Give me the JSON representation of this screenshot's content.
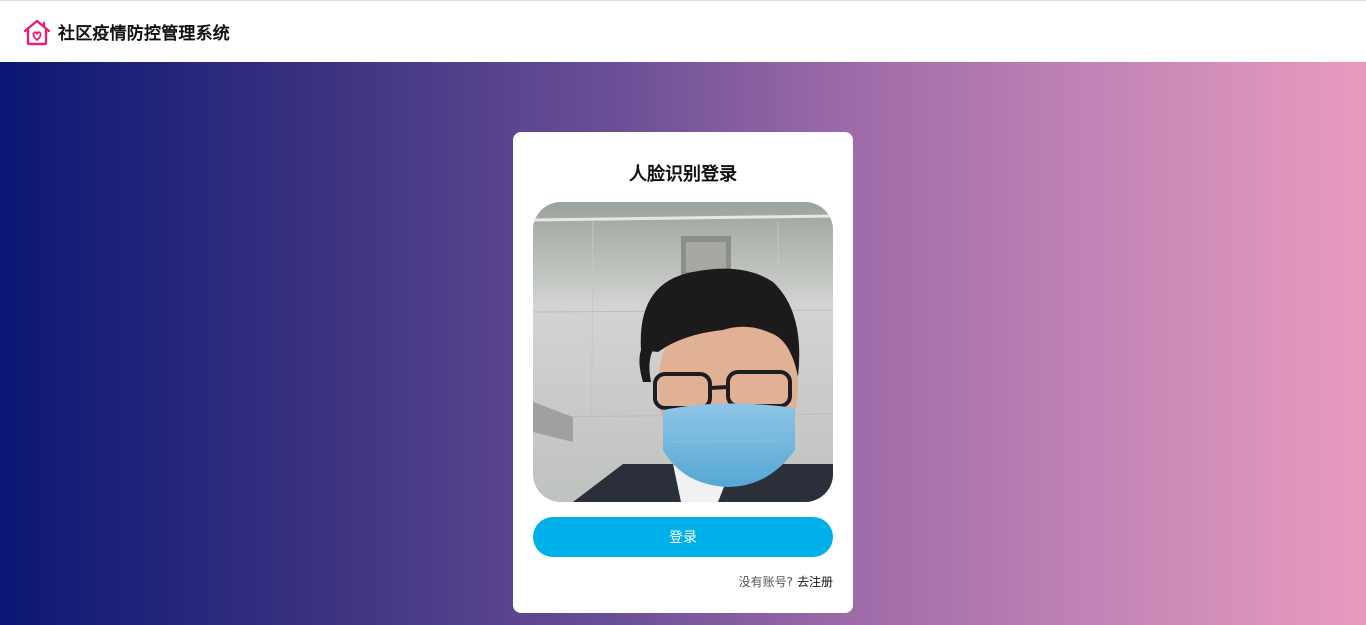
{
  "header": {
    "title": "社区疫情防控管理系统",
    "logo_icon": "house-heart-icon",
    "logo_color": "#e8207a"
  },
  "login_card": {
    "title": "人脸识别登录",
    "camera_feed": "webcam-preview",
    "login_button": "登录",
    "no_account_text": "没有账号?",
    "register_link": "去注册"
  },
  "colors": {
    "accent": "#00b0e8",
    "gradient_start": "#0b1775",
    "gradient_end": "#e99bbf"
  }
}
